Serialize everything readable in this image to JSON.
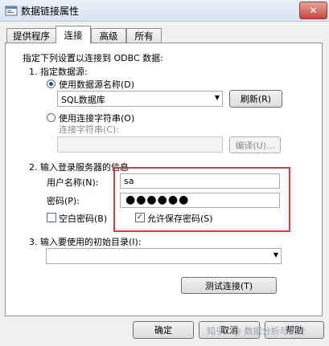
{
  "window": {
    "title": "数据链接属性",
    "close_glyph": "✕"
  },
  "tabs": [
    {
      "label": "提供程序"
    },
    {
      "label": "连接"
    },
    {
      "label": "高级"
    },
    {
      "label": "所有"
    }
  ],
  "active_tab": "连接",
  "intro": "指定下列设置以连接到 ODBC 数据:",
  "step1": {
    "heading": "1. 指定数据源:",
    "use_dsn_label": "使用数据源名称(D)",
    "use_dsn_selected": true,
    "dsn_value": "SQL数据库",
    "refresh_button": "刷新(R)",
    "use_connstr_label": "使用连接字符串(O)",
    "connstr_label": "连接字符串(C):",
    "connstr_value": "",
    "build_button": "编译(U)..."
  },
  "step2": {
    "heading": "2. 输入登录服务器的信息",
    "username_label": "用户名称(N):",
    "username_value": "sa",
    "password_label": "密码(P):",
    "password_mask": "●●●●●●",
    "blank_password_label": "空白密码(B)",
    "blank_password_checked": false,
    "allow_save_label": "允许保存密码(S)",
    "allow_save_checked": true
  },
  "step3": {
    "heading": "3. 输入要使用的初始目录(I):",
    "catalog_value": ""
  },
  "test_button": "测试连接(T)",
  "footer": {
    "ok_button": "确定",
    "cancel_button": "取消",
    "help_button": "帮助"
  },
  "watermark": {
    "left_text": "知乎",
    "right_text": "@ 数据分析与统计"
  },
  "colors": {
    "highlight_box": "#d63b3b",
    "titlebar": "#dbe6f3",
    "close_button": "#c4473a"
  }
}
